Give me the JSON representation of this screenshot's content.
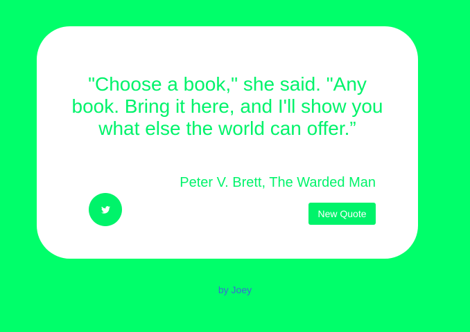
{
  "quote_box": {
    "text": "\"Choose a book,\" she said. \"Any book. Bring it here, and I'll show you what else the world can offer.”",
    "author": "Peter V. Brett, The Warded Man"
  },
  "actions": {
    "tweet_icon": "twitter-icon",
    "new_quote_label": "New Quote"
  },
  "footer": {
    "credit_text": "by Joey"
  },
  "colors": {
    "background": "#00ff6a",
    "accent": "#00f36a",
    "card": "#ffffff",
    "link": "#3a6ad6"
  }
}
